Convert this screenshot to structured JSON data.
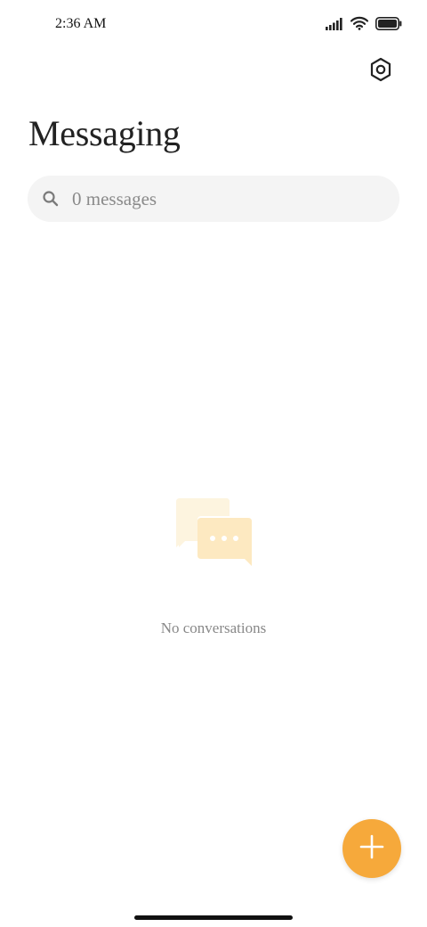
{
  "status_bar": {
    "time": "2:36 AM",
    "signal_icon": "signal-icon",
    "wifi_icon": "wifi-icon",
    "battery_icon": "battery-icon"
  },
  "header": {
    "settings_icon": "settings-hexagon-icon",
    "title": "Messaging"
  },
  "search": {
    "icon": "search-icon",
    "placeholder": "0 messages"
  },
  "empty_state": {
    "icon": "chat-bubbles-icon",
    "text": "No conversations"
  },
  "fab": {
    "icon": "plus-icon"
  },
  "colors": {
    "accent": "#f6a93b",
    "search_bg": "#f4f4f4",
    "empty_icon_light": "#fdf4df",
    "empty_icon_dark": "#fde9c1",
    "muted_text": "#888888"
  }
}
